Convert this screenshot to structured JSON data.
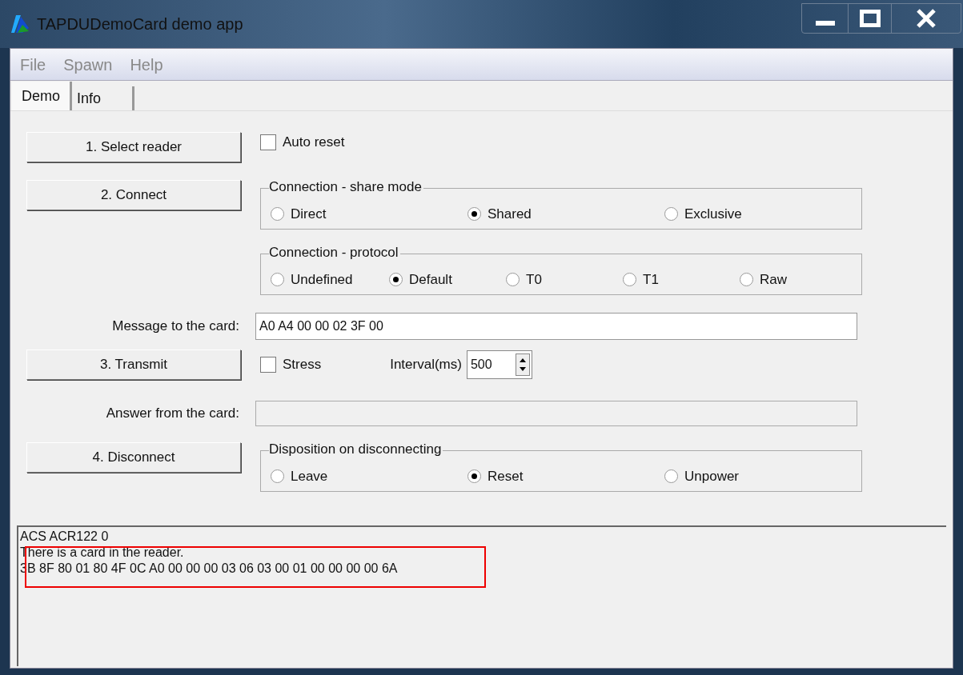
{
  "window": {
    "title": "TAPDUDemoCard demo app"
  },
  "menu": [
    "File",
    "Spawn",
    "Help"
  ],
  "tabs": [
    {
      "label": "Demo",
      "selected": true
    },
    {
      "label": "Info",
      "selected": false
    }
  ],
  "select_reader": {
    "button": "1. Select reader",
    "auto_reset": {
      "label": "Auto reset",
      "checked": false
    }
  },
  "connect": {
    "button": "2. Connect"
  },
  "share_mode": {
    "title": "Connection - share mode",
    "options": [
      {
        "label": "Direct",
        "selected": false
      },
      {
        "label": "Shared",
        "selected": true
      },
      {
        "label": "Exclusive",
        "selected": false
      }
    ]
  },
  "protocol": {
    "title": "Connection - protocol",
    "options": [
      {
        "label": "Undefined",
        "selected": false
      },
      {
        "label": "Default",
        "selected": true
      },
      {
        "label": "T0",
        "selected": false
      },
      {
        "label": "T1",
        "selected": false
      },
      {
        "label": "Raw",
        "selected": false
      }
    ]
  },
  "message": {
    "label": "Message to the card:",
    "value": "A0 A4 00 00 02 3F 00"
  },
  "transmit": {
    "button": "3. Transmit",
    "stress": {
      "label": "Stress",
      "checked": false
    },
    "interval_label": "Interval(ms)",
    "interval_value": "500"
  },
  "answer": {
    "label": "Answer from the card:"
  },
  "disconnect": {
    "button": "4. Disconnect"
  },
  "disposition": {
    "title": "Disposition on disconnecting",
    "options": [
      {
        "label": "Leave",
        "selected": false
      },
      {
        "label": "Reset",
        "selected": true
      },
      {
        "label": "Unpower",
        "selected": false
      }
    ]
  },
  "log": {
    "lines": [
      "ACS ACR122 0",
      "There is a card in the reader.",
      "3B 8F 80 01 80 4F 0C A0 00 00 00 03 06 03 00 01 00 00 00 00 6A"
    ],
    "highlight": true
  }
}
